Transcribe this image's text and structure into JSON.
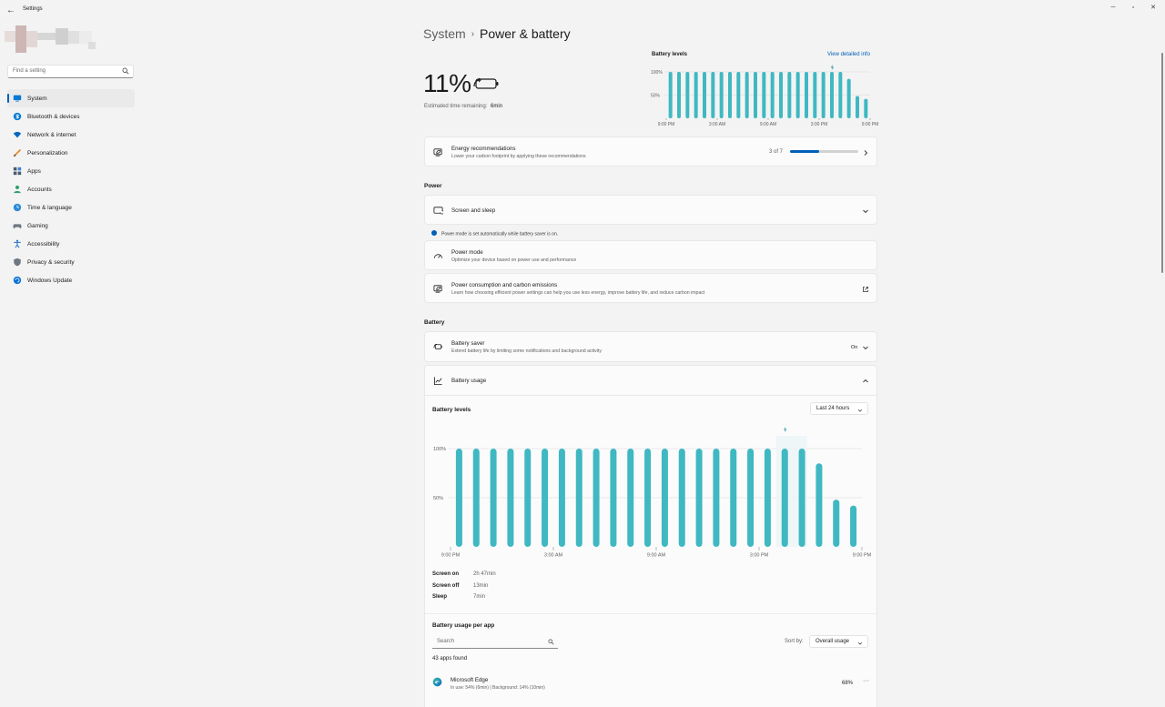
{
  "window": {
    "title": "Settings",
    "back_glyph": "←",
    "minimize_glyph": "─",
    "maximize_glyph": "▫",
    "close_glyph": "✕"
  },
  "sidebar": {
    "search_placeholder": "Find a setting",
    "items": [
      {
        "label": "System",
        "icon": "monitor-icon",
        "color": "#0078d4"
      },
      {
        "label": "Bluetooth & devices",
        "icon": "bluetooth-icon",
        "color": "#0078d4"
      },
      {
        "label": "Network & internet",
        "icon": "wifi-icon",
        "color": "#0067c0"
      },
      {
        "label": "Personalization",
        "icon": "brush-icon",
        "color": "#e88b2e"
      },
      {
        "label": "Apps",
        "icon": "apps-icon",
        "color": "#4b5a6d"
      },
      {
        "label": "Accounts",
        "icon": "person-icon",
        "color": "#2fa36b"
      },
      {
        "label": "Time & language",
        "icon": "globe-clock-icon",
        "color": "#2d8ad6"
      },
      {
        "label": "Gaming",
        "icon": "gamepad-icon",
        "color": "#6e7882"
      },
      {
        "label": "Accessibility",
        "icon": "accessibility-icon",
        "color": "#1d6fc8"
      },
      {
        "label": "Privacy & security",
        "icon": "shield-icon",
        "color": "#6e7882"
      },
      {
        "label": "Windows Update",
        "icon": "update-icon",
        "color": "#0a72d6"
      }
    ]
  },
  "header": {
    "crumb": "System",
    "separator": "›",
    "title": "Power & battery"
  },
  "summary": {
    "percent": "11%",
    "estimate_label": "Estimated time remaining:",
    "estimate_value": "6min"
  },
  "mini_chart": {
    "title": "Battery levels",
    "link": "View detailed info",
    "y_labels": [
      "100%",
      "50%"
    ],
    "x_labels": [
      "9:00 PM",
      "3:00 AM",
      "9:00 AM",
      "3:00 PM",
      "9:00 PM"
    ]
  },
  "energy": {
    "title": "Energy recommendations",
    "subtitle": "Lower your carbon footprint by applying these recommendations",
    "count": "3 of 7",
    "progress_fraction": 0.43
  },
  "power": {
    "section": "Power",
    "screen_sleep": "Screen and sleep",
    "info": "Power mode is set automatically while battery saver is on.",
    "mode_title": "Power mode",
    "mode_subtitle": "Optimize your device based on power use and performance",
    "carbon_title": "Power consumption and carbon emissions",
    "carbon_subtitle": "Learn how choosing efficient power settings can help you use less energy, improve battery life, and reduce carbon impact"
  },
  "battery": {
    "section": "Battery",
    "saver_title": "Battery saver",
    "saver_subtitle": "Extend battery life by limiting some notifications and background activity",
    "saver_state": "On",
    "usage_title": "Battery usage",
    "levels_title": "Battery levels",
    "range": "Last 24 hours",
    "stats": [
      {
        "label": "Screen on",
        "value": "2h 47min"
      },
      {
        "label": "Screen off",
        "value": "13min"
      },
      {
        "label": "Sleep",
        "value": "7min"
      }
    ],
    "per_app_title": "Battery usage per app",
    "per_app_search": "Search",
    "apps_found": "43 apps found",
    "sort_label": "Sort by:",
    "sort_value": "Overall usage",
    "apps": [
      {
        "name": "Microsoft Edge",
        "detail": "In use: 54% (6min) | Background: 14% (10min)",
        "percent": "68%"
      }
    ]
  },
  "chart_data": {
    "type": "bar",
    "title": "Battery levels",
    "y_ticks": [
      "100%",
      "50%"
    ],
    "ylim": [
      0,
      100
    ],
    "x_tick_labels": [
      "9:00 PM",
      "3:00 AM",
      "9:00 AM",
      "3:00 PM",
      "9:00 PM"
    ],
    "values": [
      100,
      100,
      100,
      100,
      100,
      100,
      100,
      100,
      100,
      100,
      100,
      100,
      100,
      100,
      100,
      100,
      100,
      100,
      100,
      100,
      100,
      85,
      48,
      42
    ],
    "charging_marker_index": 19,
    "bar_color": "#3fb8c2"
  }
}
